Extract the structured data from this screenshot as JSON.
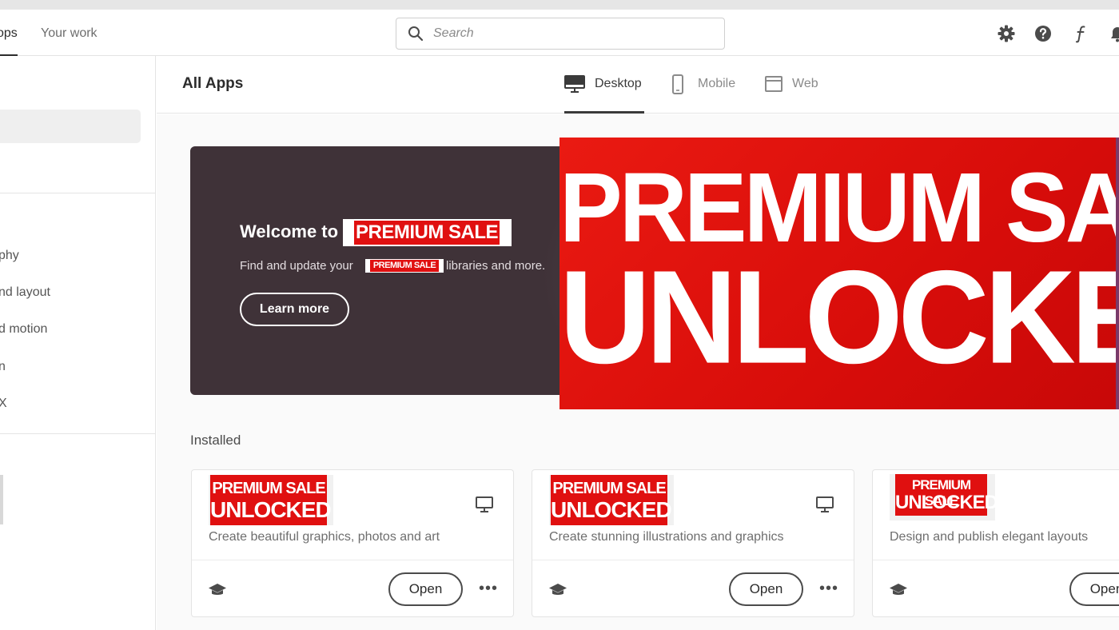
{
  "header": {
    "nav": [
      {
        "label": "ops"
      },
      {
        "label": "Your work"
      }
    ],
    "search_placeholder": "Search",
    "icons": [
      "gear-icon",
      "help-icon",
      "fonts-icon",
      "bell-icon"
    ]
  },
  "sidebar": {
    "items": [
      {
        "label": "phy"
      },
      {
        "label": "nd layout"
      },
      {
        "label": "d motion"
      },
      {
        "label": "n"
      },
      {
        "label": "X"
      }
    ]
  },
  "main": {
    "title": "All Apps",
    "tabs": [
      {
        "label": "Desktop",
        "icon": "desktop-icon",
        "selected": true
      },
      {
        "label": "Mobile",
        "icon": "mobile-icon",
        "selected": false
      },
      {
        "label": "Web",
        "icon": "web-icon",
        "selected": false
      }
    ]
  },
  "banner": {
    "welcome_prefix": "Welcome to",
    "sticker_text": "PREMIUM SALE",
    "sub_prefix": "Find and update your",
    "sub_sticker": "PREMIUM SALE",
    "sub_suffix": "libraries and more.",
    "learn_more": "Learn more",
    "bg_color": "#4c3f46"
  },
  "promo": {
    "line1": "PREMIUM SALE",
    "line2": "UNLOCKED",
    "color": "#e01010"
  },
  "installed": {
    "title": "Installed",
    "cards": [
      {
        "sticker_l1": "PREMIUM SALE",
        "sticker_l2": "UNLOCKED",
        "description": "Create beautiful graphics, photos and art",
        "open_label": "Open",
        "more_label": "•••"
      },
      {
        "sticker_l1": "PREMIUM SALE",
        "sticker_l2": "UNLOCKED",
        "description": "Create stunning illustrations and graphics",
        "open_label": "Open",
        "more_label": "•••"
      },
      {
        "sticker_l1": "PREMIUM SALE",
        "sticker_l2": "UNLOCKED",
        "description": "Design and publish elegant layouts",
        "open_label": "Open",
        "more_label": "•••"
      }
    ]
  }
}
